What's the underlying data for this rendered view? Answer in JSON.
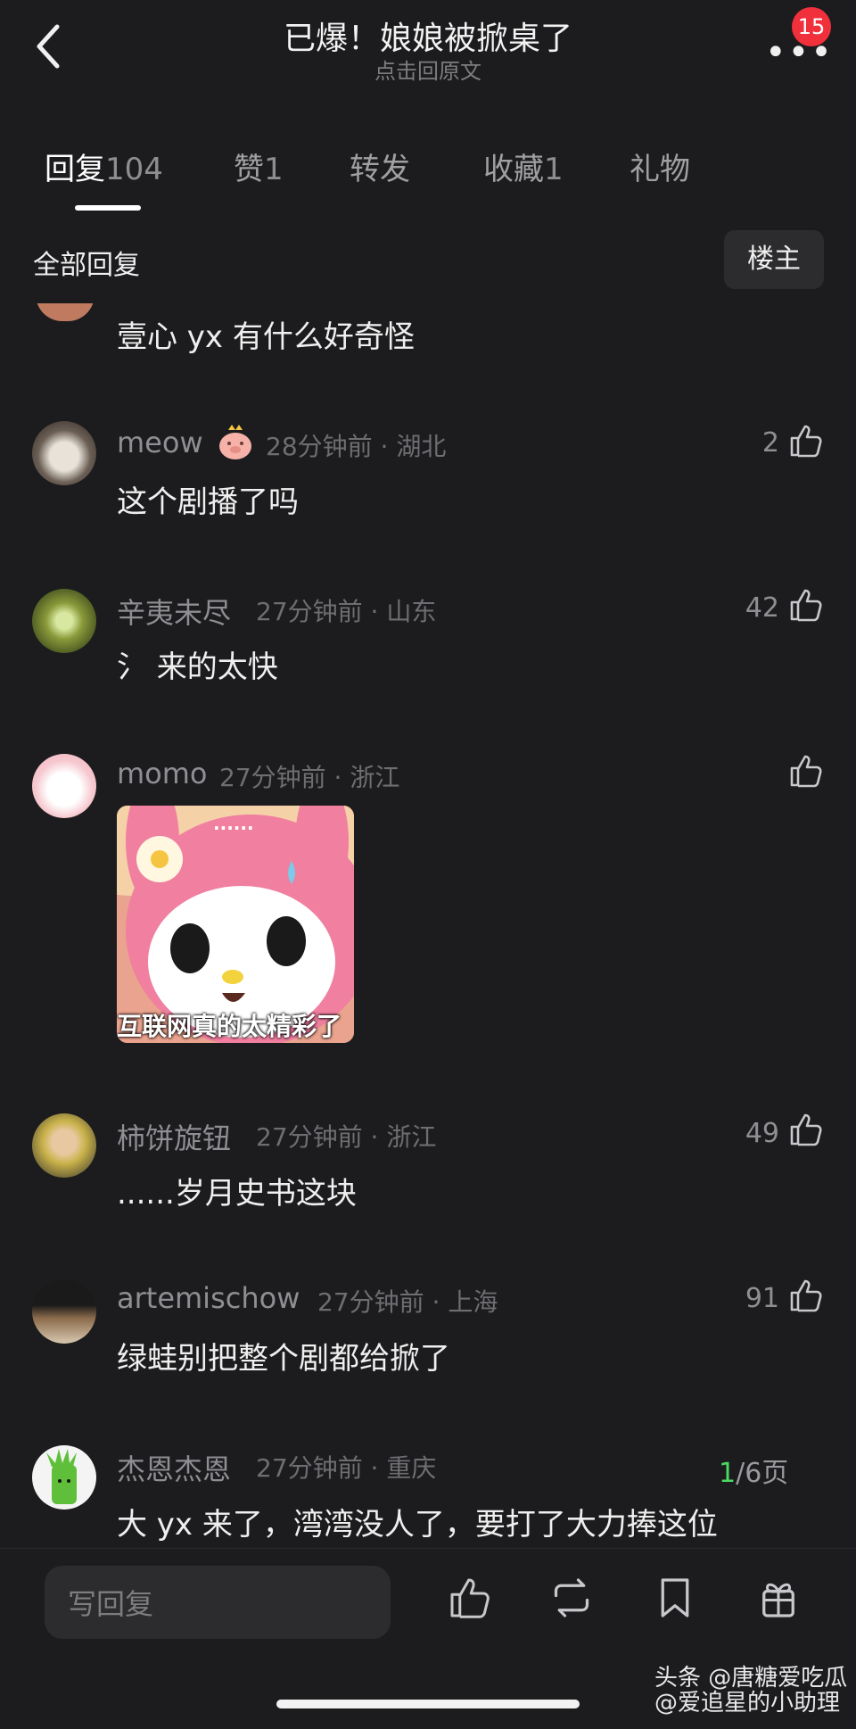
{
  "header": {
    "title": "已爆！娘娘被掀桌了",
    "subtitle": "点击回原文",
    "notif_count": "15",
    "more_glyph": "•••"
  },
  "tabs": [
    {
      "label": "回复",
      "count": "104",
      "active": true
    },
    {
      "label": "赞",
      "count": "1"
    },
    {
      "label": "转发",
      "count": ""
    },
    {
      "label": "收藏",
      "count": "1"
    },
    {
      "label": "礼物",
      "count": ""
    }
  ],
  "filter": {
    "all_label": "全部回复",
    "op_label": "楼主"
  },
  "comments": [
    {
      "text": "壹心 yx 有什么好奇怪"
    },
    {
      "user": "meow",
      "meta": "28分钟前 · 湖北",
      "likes": "2",
      "text": "这个剧播了吗"
    },
    {
      "user": "辛夷未尽",
      "meta": "27分钟前 · 山东",
      "likes": "42",
      "text": "氵 来的太快"
    },
    {
      "user": "momo",
      "meta": "27分钟前 · 浙江",
      "likes": "",
      "sticker_dots": "......",
      "sticker_caption": "互联网真的太精彩了"
    },
    {
      "user": "柿饼旋钮",
      "meta": "27分钟前 · 浙江",
      "likes": "49",
      "text": "......岁月史书这块"
    },
    {
      "user": "artemischow",
      "meta": "27分钟前 · 上海",
      "likes": "91",
      "text": "绿蛙别把整个剧都给掀了"
    },
    {
      "user": "杰恩杰恩",
      "meta": "27分钟前 · 重庆",
      "likes": "",
      "text": "大 yx 来了，湾湾没人了，要打了大力捧这位"
    }
  ],
  "pagination": {
    "current": "1",
    "total_label": "/6页"
  },
  "bottom": {
    "reply_placeholder": "写回复"
  },
  "watermark": {
    "line1": "头条 @唐糖爱吃瓜",
    "line2": "@爱追星的小助理"
  },
  "colors": {
    "background": "#1c1c1e",
    "badge": "#f0313c",
    "page_current": "#4cd964"
  }
}
